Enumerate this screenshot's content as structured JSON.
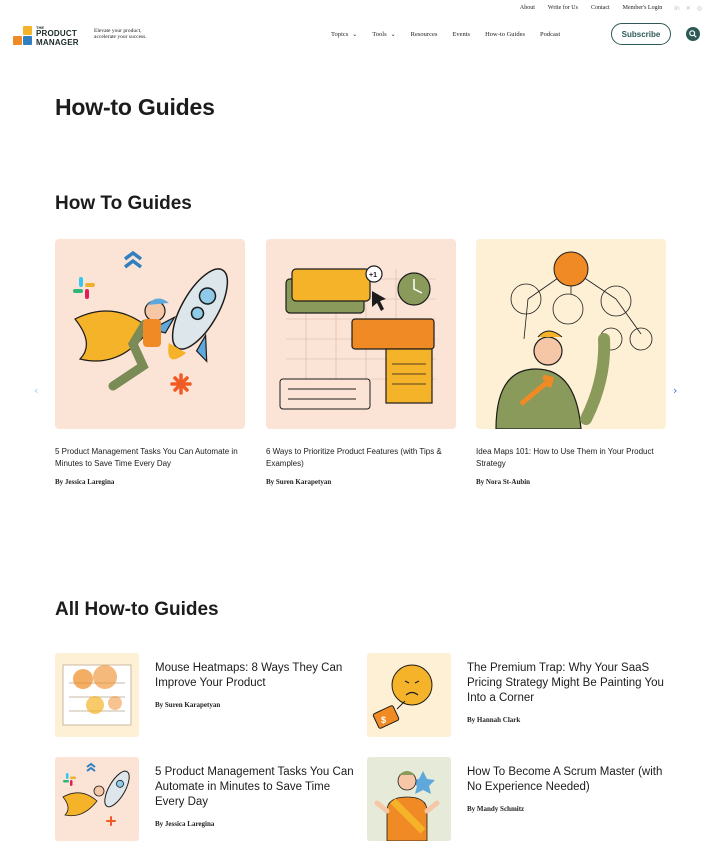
{
  "utility_nav": [
    "About",
    "Write for Us",
    "Contact",
    "Member's Login"
  ],
  "social_icons": [
    "linkedin-icon",
    "x-icon",
    "instagram-icon"
  ],
  "brand": {
    "logo_the": "THE",
    "logo_word1": "PRODUCT",
    "logo_word2": "MANAGER",
    "tagline_line1": "Elevate your product,",
    "tagline_line2": "accelerate your success.",
    "colors": {
      "orange": "#f08a24",
      "teal": "#2d5a56",
      "blue": "#2f7fc1",
      "yellow": "#f5b32a"
    }
  },
  "nav": {
    "topics": "Topics",
    "tools": "Tools",
    "resources": "Resources",
    "events": "Events",
    "howto": "How-to Guides",
    "podcast": "Podcast",
    "subscribe": "Subscribe"
  },
  "page_title": "How-to Guides",
  "featured": {
    "heading": "How To Guides",
    "cards": [
      {
        "title": "5 Product Management Tasks You Can Automate in Minutes to Save Time Every Day",
        "author": "By Jessica Laregina"
      },
      {
        "title": "6 Ways to Prioritize Product Features (with Tips & Examples)",
        "author": "By Suren Karapetyan"
      },
      {
        "title": "Idea Maps 101: How to Use Them in Your Product Strategy",
        "author": "By Nora St-Aubin"
      }
    ],
    "badge": "+1"
  },
  "all_guides": {
    "heading": "All How-to Guides",
    "items": [
      {
        "title": "Mouse Heatmaps: 8 Ways They Can Improve Your Product",
        "author": "By Suren Karapetyan"
      },
      {
        "title": "The Premium Trap: Why Your SaaS Pricing Strategy Might Be Painting You Into a Corner",
        "author": "By Hannah Clark"
      },
      {
        "title": "5 Product Management Tasks You Can Automate in Minutes to Save Time Every Day",
        "author": "By Jessica Laregina"
      },
      {
        "title": "How To Become A Scrum Master (with No Experience Needed)",
        "author": "By Mandy Schmitz"
      }
    ]
  }
}
